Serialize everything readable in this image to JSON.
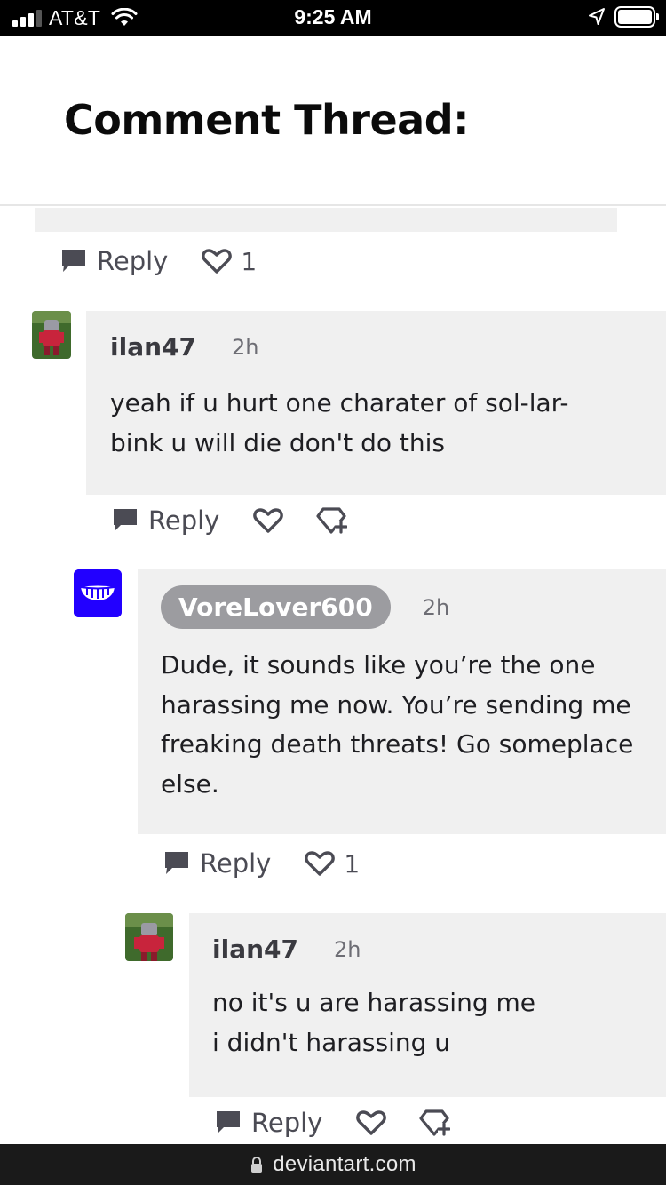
{
  "status_bar": {
    "carrier": "AT&T",
    "time": "9:25 AM",
    "signal_bars": 4,
    "signal_bars_filled": 3,
    "battery_level": 1.0
  },
  "header": {
    "title": "Comment Thread:"
  },
  "labels": {
    "reply": "Reply"
  },
  "top_actions": {
    "likes": "1"
  },
  "comments": [
    {
      "username": "ilan47",
      "time": "2h",
      "text": "yeah if u hurt one charater of sol-lar-\nbink u will die don't do this",
      "likes": "",
      "avatar_icon": "robot-avatar-icon",
      "show_award": true
    },
    {
      "username": "VoreLover600",
      "time": "2h",
      "text": "Dude, it sounds like you’re the one\nharassing me now. You’re sending me\nfreaking death threats! Go someplace\nelse.",
      "likes": "1",
      "avatar_icon": "grin-avatar-icon",
      "show_award": false
    },
    {
      "username": "ilan47",
      "time": "2h",
      "text": "no it's u are harassing me\ni didn't harassing u",
      "likes": "",
      "avatar_icon": "robot-avatar-icon",
      "show_award": true
    }
  ],
  "url_bar": {
    "domain": "deviantart.com"
  },
  "colors": {
    "bubble_bg": "#f0f0f0",
    "action_gray": "#4b4b54",
    "pill_gray": "#9c9ca0",
    "avatar_blue": "#2200ff"
  }
}
